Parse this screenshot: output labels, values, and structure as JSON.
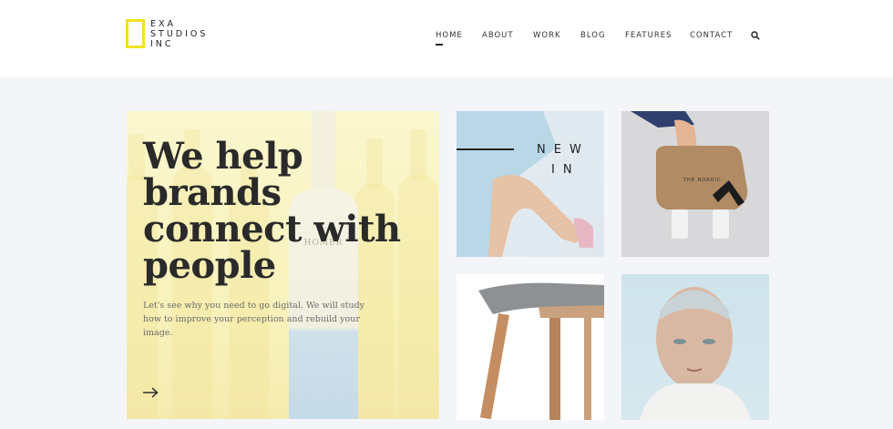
{
  "logo": {
    "line1": "EXA",
    "line2": "STUDIOS",
    "line3": "INC",
    "accent_color": "#f2e21c"
  },
  "nav": {
    "items": [
      {
        "label": "HOME",
        "active": true
      },
      {
        "label": "ABOUT",
        "active": false
      },
      {
        "label": "WORK",
        "active": false
      },
      {
        "label": "BLOG",
        "active": false
      },
      {
        "label": "FEATURES",
        "active": false
      },
      {
        "label": "CONTACT",
        "active": false
      }
    ],
    "search_icon": "search-icon"
  },
  "hero": {
    "title": "We help brands connect with people",
    "subtitle": "Let's see why you need to go digital. We will study how to improve your perception and rebuild your image.",
    "bottle_label": "HOMER",
    "arrow_icon": "arrow-right-icon",
    "background_color": "#f8f2bc"
  },
  "tiles": [
    {
      "id": "new-in",
      "caption_line1": "NEW",
      "caption_line2": "IN"
    },
    {
      "id": "packaging",
      "brand_text": "THE NORDIC"
    },
    {
      "id": "chair"
    },
    {
      "id": "portrait"
    }
  ]
}
